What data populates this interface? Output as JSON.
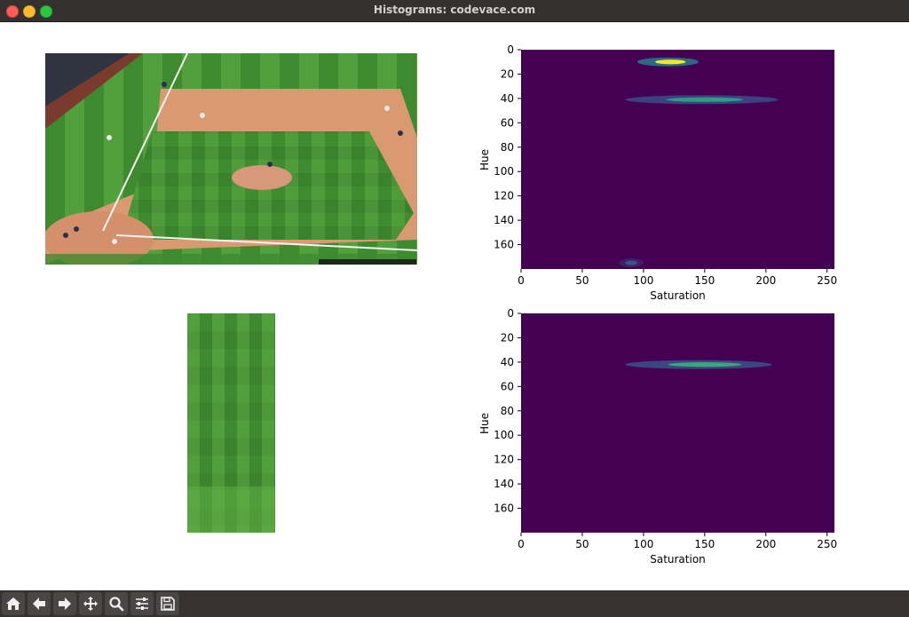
{
  "window": {
    "title": "Histograms: codevace.com"
  },
  "toolbar": {
    "buttons": [
      {
        "name": "home-icon"
      },
      {
        "name": "back-arrow-icon"
      },
      {
        "name": "forward-arrow-icon"
      },
      {
        "name": "pan-move-icon"
      },
      {
        "name": "zoom-magnifier-icon"
      },
      {
        "name": "configure-subplots-icon"
      },
      {
        "name": "save-disk-icon"
      }
    ]
  },
  "chart_data": [
    {
      "type": "heatmap",
      "xlabel": "Saturation",
      "ylabel": "Hue",
      "xlim": [
        0,
        256
      ],
      "ylim": [
        180,
        0
      ],
      "xticks": [
        "0",
        "50",
        "100",
        "150",
        "200",
        "250"
      ],
      "yticks": [
        "0",
        "20",
        "40",
        "60",
        "80",
        "100",
        "120",
        "140",
        "160"
      ],
      "colormap": "viridis",
      "background_color": "#440154",
      "hotspots": [
        {
          "hue": 10,
          "saturation": [
            95,
            145
          ],
          "peak_saturation": 122,
          "intensity": 1.0
        },
        {
          "hue": 41,
          "saturation": [
            85,
            210
          ],
          "peak_saturation": 150,
          "intensity": 0.55
        },
        {
          "hue": 175,
          "saturation": [
            80,
            100
          ],
          "peak_saturation": 90,
          "intensity": 0.25
        }
      ]
    },
    {
      "type": "heatmap",
      "xlabel": "Saturation",
      "ylabel": "Hue",
      "xlim": [
        0,
        256
      ],
      "ylim": [
        180,
        0
      ],
      "xticks": [
        "0",
        "50",
        "100",
        "150",
        "200",
        "250"
      ],
      "yticks": [
        "0",
        "20",
        "40",
        "60",
        "80",
        "100",
        "120",
        "140",
        "160"
      ],
      "colormap": "viridis",
      "background_color": "#440154",
      "hotspots": [
        {
          "hue": 42,
          "saturation": [
            85,
            205
          ],
          "peak_saturation": 150,
          "intensity": 0.6
        }
      ]
    }
  ]
}
